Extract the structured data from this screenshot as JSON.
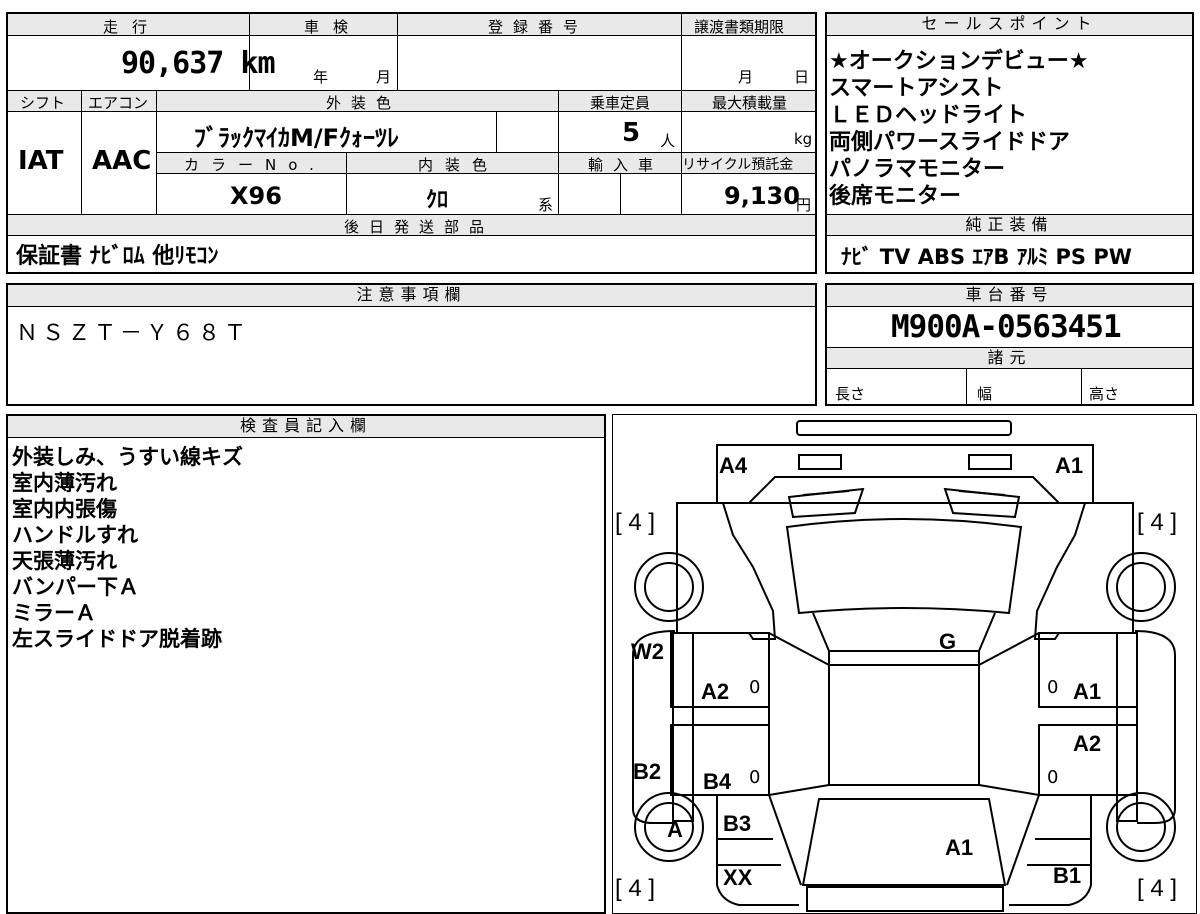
{
  "sheet": {
    "labels": {
      "mileage": "走行",
      "inspection": "車検",
      "registration_no": "登録番号",
      "transfer_deadline": "譲渡書類期限",
      "sales_points": "セールスポイント",
      "shift": "シフト",
      "aircon": "エアコン",
      "exterior_color": "外装色",
      "capacity": "乗車定員",
      "max_load": "最大積載量",
      "color_no": "カラーNo.",
      "interior_color": "内装色",
      "import": "輸入車",
      "recycle_deposit": "リサイクル預託金",
      "later_shipping": "後日発送部品",
      "genuine_equipment": "純正装備",
      "notes": "注意事項欄",
      "chassis_no": "車台番号",
      "specs": "諸元",
      "length": "長さ",
      "width": "幅",
      "height": "高さ",
      "inspector_notes": "検査員記入欄"
    },
    "units": {
      "year": "年",
      "month": "月",
      "day": "日",
      "person": "人",
      "kg": "kg",
      "yen": "円",
      "series": "系"
    },
    "values": {
      "mileage": "90,637 km",
      "shift": "IAT",
      "aircon": "AAC",
      "exterior_color": "ﾌﾞﾗｯｸﾏｲｶM/Fｸｫｰﾂﾚ",
      "capacity": "5",
      "color_no": "X96",
      "interior_color": "ｸﾛ",
      "recycle_deposit": "9,130",
      "later_shipping": "保証書 ﾅﾋﾞﾛﾑ 他ﾘﾓｺﾝ",
      "genuine_equipment": "ﾅﾋﾞ TV ABS ｴｱB ｱﾙﾐ PS PW",
      "notes": "ＮＳＺＴ－Ｙ６８Ｔ",
      "chassis_no": "M900A-0563451"
    },
    "sales_points": [
      "★オークションデビュー★",
      "スマートアシスト",
      "ＬＥＤヘッドライト",
      "両側パワースライドドア",
      "パノラマモニター",
      "後席モニター"
    ],
    "inspector_comments": [
      "外装しみ、うすい線キズ",
      "室内薄汚れ",
      "室内内張傷",
      "ハンドルすれ",
      "天張薄汚れ",
      "バンパー下Ａ",
      "ミラーＡ",
      "左スライドドア脱着跡"
    ]
  },
  "diagram": {
    "marks": {
      "front_left": "A4",
      "front_right": "A1",
      "windshield": "G",
      "left_front_panel": "W2",
      "left_front_door": "A2",
      "left_rear_door": "B4",
      "left_rear_quarter": "B2",
      "left_rear_wheel": "A",
      "left_sill": "B3",
      "left_rear": "XX",
      "right_front_door": "A1",
      "right_rear_door": "A2",
      "rear_center": "A1",
      "right_rear": "B1"
    },
    "tire_tl": "[ 4 ]",
    "tire_tr": "[ 4 ]",
    "tire_bl": "[ 4 ]",
    "tire_br": "[ 4 ]",
    "zero_a": "0",
    "zero_b": "0",
    "zero_c": "0",
    "zero_d": "0"
  }
}
